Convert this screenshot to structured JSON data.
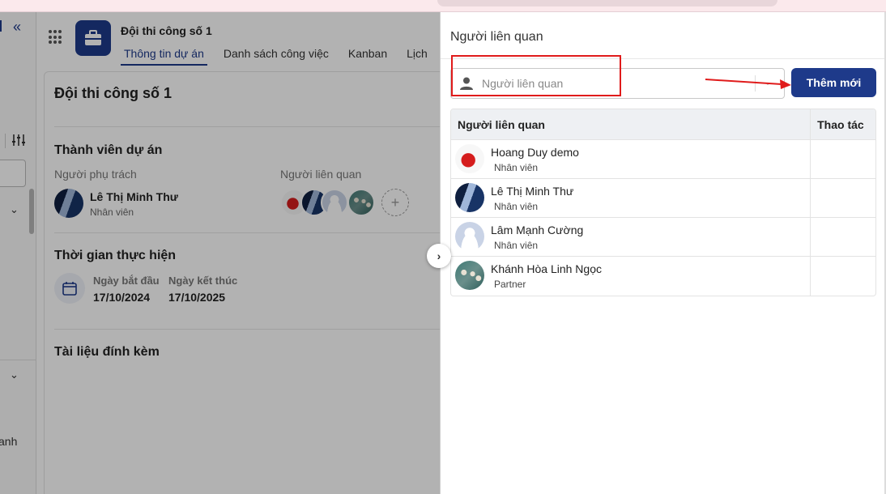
{
  "project": {
    "title": "Đội thi công số 1",
    "tabs": [
      "Thông tin dự án",
      "Danh sách công việc",
      "Kanban",
      "Lịch"
    ],
    "card_title": "Đội thi công số 1",
    "members_section": "Thành viên dự án",
    "owner_label": "Người phụ trách",
    "owner": {
      "name": "Lê Thị Minh Thư",
      "role": "Nhân viên"
    },
    "related_label": "Người liên quan",
    "time_section": "Thời gian thực hiện",
    "start_label": "Ngày bắt đầu",
    "start_value": "17/10/2024",
    "end_label": "Ngày kết thúc",
    "end_value": "17/10/2025",
    "attachments_section": "Tài liệu đính kèm",
    "rail_text": "anh"
  },
  "drawer": {
    "title": "Người liên quan",
    "search_placeholder": "Người liên quan",
    "add_button": "Thêm mới",
    "table_headers": [
      "Người liên quan",
      "Thao tác"
    ],
    "rows": [
      {
        "name": "Hoang Duy demo",
        "role": "Nhân viên",
        "avatar": "rose-avatar"
      },
      {
        "name": "Lê Thị Minh Thư",
        "role": "Nhân viên",
        "avatar": "building-avatar"
      },
      {
        "name": "Lâm Mạnh Cường",
        "role": "Nhân viên",
        "avatar": "default-avatar"
      },
      {
        "name": "Khánh Hòa Linh Ngọc",
        "role": "Partner",
        "avatar": "crowd-avatar"
      }
    ]
  },
  "colors": {
    "primary": "#1e3a8a",
    "annotation_red": "#e01b1b"
  }
}
